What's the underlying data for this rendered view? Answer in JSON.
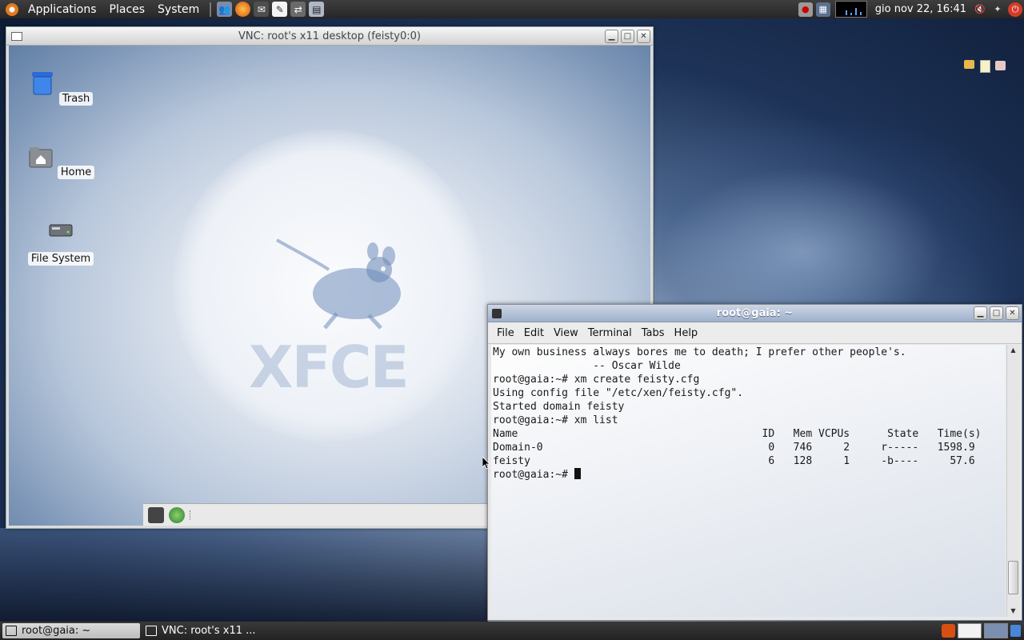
{
  "top_panel": {
    "menus": [
      "Applications",
      "Places",
      "System"
    ],
    "launchers": [
      "people-icon",
      "firefox-icon",
      "mail-icon",
      "editor-icon",
      "network-icon",
      "terminal-icon"
    ],
    "clock": "gio nov 22, 16:41"
  },
  "vnc_window": {
    "title": "VNC: root's x11 desktop (feisty0:0)",
    "desktop_icons": [
      {
        "label": "Trash",
        "icon": "trash-icon"
      },
      {
        "label": "Home",
        "icon": "home-folder-icon"
      },
      {
        "label": "File System",
        "icon": "drive-icon"
      }
    ],
    "panel_text": "1"
  },
  "terminal_window": {
    "title": "root@gaia: ~",
    "menus": [
      "File",
      "Edit",
      "View",
      "Terminal",
      "Tabs",
      "Help"
    ],
    "lines": [
      "My own business always bores me to death; I prefer other people's.",
      "                -- Oscar Wilde",
      "root@gaia:~# xm create feisty.cfg",
      "Using config file \"/etc/xen/feisty.cfg\".",
      "Started domain feisty",
      "root@gaia:~# xm list",
      "Name                                       ID   Mem VCPUs      State   Time(s)",
      "Domain-0                                    0   746     2     r-----   1598.9",
      "feisty                                      6   128     1     -b----     57.6"
    ],
    "prompt": "root@gaia:~# "
  },
  "taskbar": {
    "tasks": [
      {
        "label": "root@gaia: ~",
        "active": true
      },
      {
        "label": "VNC: root's x11 ...",
        "active": false
      }
    ]
  },
  "colors": {
    "accent": "#e07a1f",
    "terminal_title_bar": "#9fb0cb"
  }
}
